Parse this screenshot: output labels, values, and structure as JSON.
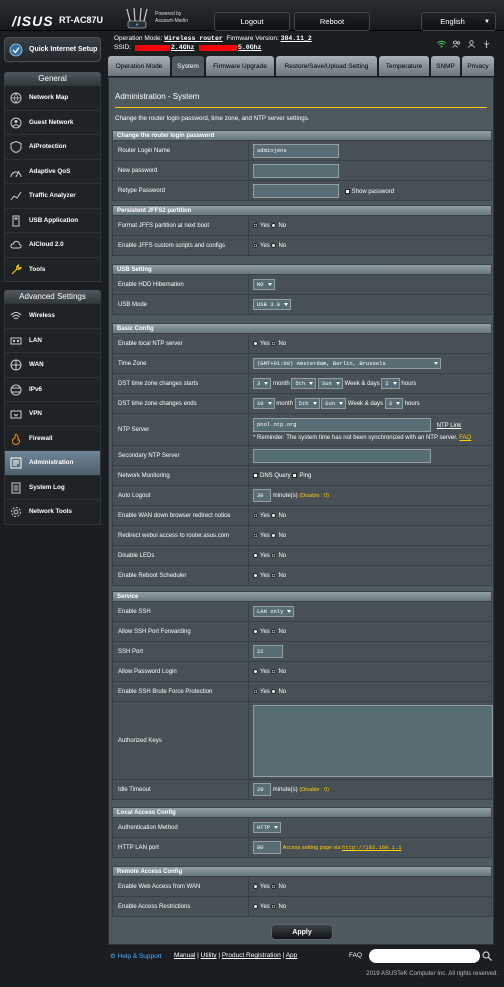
{
  "header": {
    "brand": "/ISUS",
    "model": "RT-AC87U",
    "powered_by": "Powered by",
    "powered_by_name": "Asuswrt-Merlin",
    "logout": "Logout",
    "reboot": "Reboot",
    "language": "English"
  },
  "status": {
    "op_mode_label": "Operation Mode:",
    "op_mode_value": "Wireless router",
    "firmware_label": "Firmware Version:",
    "firmware_value": "384.11_2",
    "ssid_label": "SSID:",
    "ssid_24": "2.4Ghz",
    "ssid_5": "5.0Ghz"
  },
  "sidebar": {
    "quick_setup": "Quick Internet Setup",
    "general_header": "General",
    "general": [
      "Network Map",
      "Guest Network",
      "AiProtection",
      "Adaptive QoS",
      "Traffic Analyzer",
      "USB Application",
      "AiCloud 2.0",
      "Tools"
    ],
    "advanced_header": "Advanced Settings",
    "advanced": [
      "Wireless",
      "LAN",
      "WAN",
      "IPv6",
      "VPN",
      "Firewall",
      "Administration",
      "System Log",
      "Network Tools"
    ],
    "active": "Administration"
  },
  "tabs": [
    "Operation Mode",
    "System",
    "Firmware Upgrade",
    "Restore/Save/Upload Setting",
    "Temperature",
    "SNMP",
    "Privacy"
  ],
  "page": {
    "title": "Administration - System",
    "description": "Change the router login password, time zone, and NTP server settings."
  },
  "sections": {
    "login": {
      "title": "Change the router login password",
      "login_name_label": "Router Login Name",
      "login_name_value": "adminjens",
      "new_password_label": "New password",
      "retype_label": "Retype Password",
      "show_password": "Show password"
    },
    "jffs": {
      "title": "Persistent JFFS2 partition",
      "format_label": "Format JFFS partition at next boot",
      "custom_label": "Enable JFFS custom scripts and configs"
    },
    "usb": {
      "title": "USB Setting",
      "hibernation_label": "Enable HDD Hibernation",
      "hibernation_value": "NO",
      "mode_label": "USB Mode",
      "mode_value": "USB 3.0"
    },
    "basic": {
      "title": "Basic Config",
      "ntp_server_enable_label": "Enable local NTP server",
      "timezone_label": "Time Zone",
      "timezone_value": "(GMT+01:00) Amsterdam, Berlin, Brussels",
      "dst_start_label": "DST time zone changes starts",
      "dst_start": {
        "month": "3",
        "week": "5th",
        "day": "Sun",
        "hour": "2"
      },
      "dst_end_label": "DST time zone changes ends",
      "dst_end": {
        "month": "10",
        "week": "5th",
        "day": "Sun",
        "hour": "3"
      },
      "month_word": "month",
      "weekdays_word": "Week & days",
      "hours_word": "hours",
      "ntp_label": "NTP Server",
      "ntp_value": "pool.ntp.org",
      "ntp_link": "NTP Link",
      "ntp_reminder": "* Reminder: The system time has not been synchronized with an NTP server.",
      "faq": "FAQ",
      "secondary_ntp_label": "Secondary NTP Server",
      "monitoring_label": "Network Monitoring",
      "dns_query": "DNS Query",
      "ping": "Ping",
      "auto_logout_label": "Auto Logout",
      "auto_logout_value": "30",
      "auto_logout_unit": "minute(s)",
      "auto_logout_hint": "(Disable : 0)",
      "wan_redirect_label": "Enable WAN down browser redirect notice",
      "redirect_asus_label": "Redirect webui access to router.asus.com",
      "disable_leds_label": "Disable LEDs",
      "reboot_scheduler_label": "Enable Reboot Scheduler"
    },
    "service": {
      "title": "Service",
      "ssh_label": "Enable SSH",
      "ssh_value": "LAN only",
      "port_forward_label": "Allow SSH Port Forwarding",
      "ssh_port_label": "SSH Port",
      "ssh_port_value": "22",
      "password_login_label": "Allow Password Login",
      "brute_force_label": "Enable SSH Brute Force Protection",
      "authorized_keys_label": "Authorized Keys",
      "idle_timeout_label": "Idle Timeout",
      "idle_timeout_value": "20",
      "idle_unit": "minute(s)",
      "idle_hint": "(Disable : 0)"
    },
    "local": {
      "title": "Local Access Config",
      "auth_label": "Authentication Method",
      "auth_value": "HTTP",
      "http_port_label": "HTTP LAN port",
      "http_port_value": "80",
      "access_hint": "Access setting page via",
      "access_url": "http://192.168.1.1"
    },
    "remote": {
      "title": "Remote Access Config",
      "web_wan_label": "Enable Web Access from WAN",
      "restrictions_label": "Enable Access Restrictions"
    }
  },
  "radio": {
    "yes": "Yes",
    "no": "No"
  },
  "apply": "Apply",
  "footer": {
    "help": "Help & Support",
    "manual": "Manual",
    "utility": "Utility",
    "product_registration": "Product Registration",
    "app": "App",
    "faq": "FAQ",
    "copyright": "2019 ASUSTeK Computer Inc. All rights reserved."
  }
}
